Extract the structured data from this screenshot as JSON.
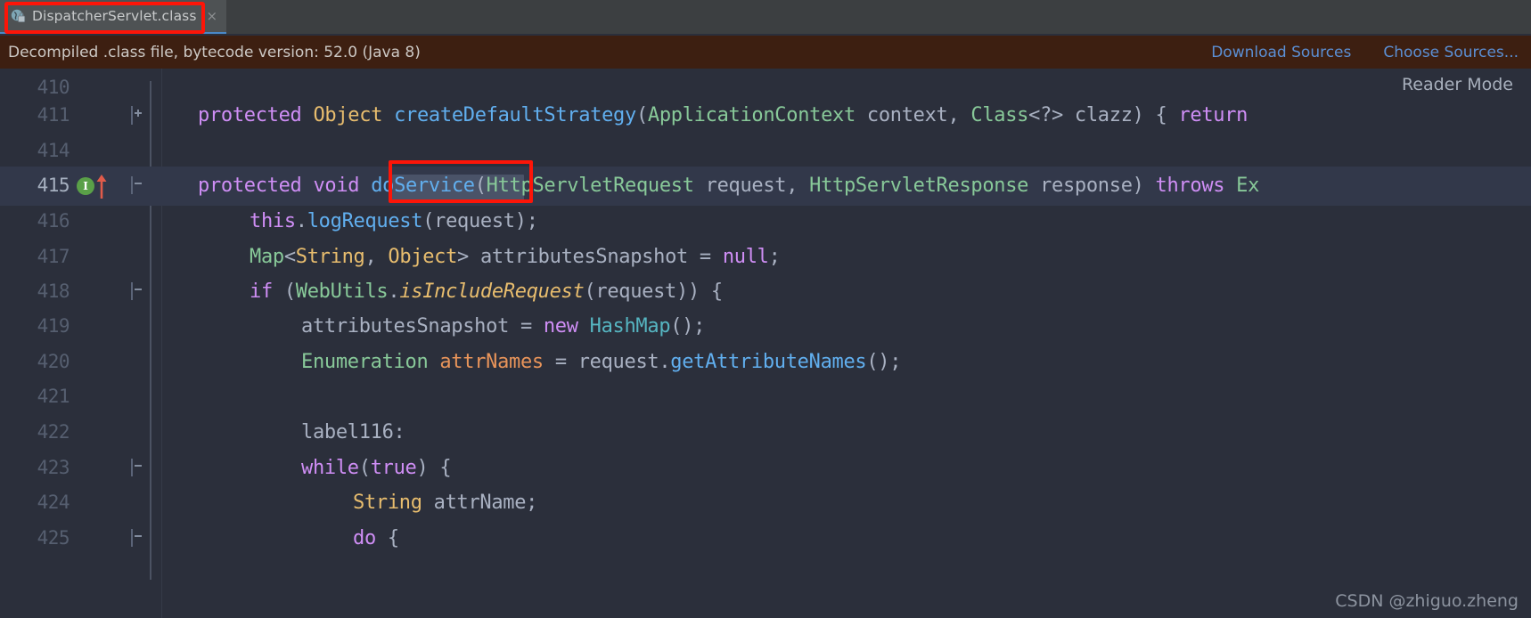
{
  "tab": {
    "label": "DispatcherServlet.class",
    "icon": "java-class-file-icon",
    "close_label": "×"
  },
  "notification": {
    "message": "Decompiled .class file, bytecode version: 52.0 (Java 8)",
    "links": [
      {
        "label": "Download Sources",
        "name": "download-sources-link"
      },
      {
        "label": "Choose Sources...",
        "name": "choose-sources-link"
      }
    ]
  },
  "editor": {
    "reader_mode_label": "Reader Mode",
    "lines": [
      {
        "no": "410",
        "indent": 0,
        "text": ""
      },
      {
        "no": "411",
        "indent": 0,
        "text": "protected Object createDefaultStrategy(ApplicationContext context, Class<?> clazz) { return"
      },
      {
        "no": "414",
        "indent": 0,
        "text": ""
      },
      {
        "no": "415",
        "indent": 0,
        "text": "protected void doService(HttpServletRequest request, HttpServletResponse response) throws Ex"
      },
      {
        "no": "416",
        "indent": 1,
        "text": "this.logRequest(request);"
      },
      {
        "no": "417",
        "indent": 1,
        "text": "Map<String, Object> attributesSnapshot = null;"
      },
      {
        "no": "418",
        "indent": 1,
        "text": "if (WebUtils.isIncludeRequest(request)) {"
      },
      {
        "no": "419",
        "indent": 2,
        "text": "attributesSnapshot = new HashMap();"
      },
      {
        "no": "420",
        "indent": 2,
        "text": "Enumeration attrNames = request.getAttributeNames();"
      },
      {
        "no": "421",
        "indent": 0,
        "text": ""
      },
      {
        "no": "422",
        "indent": 2,
        "text": "label116:"
      },
      {
        "no": "423",
        "indent": 2,
        "text": "while(true) {"
      },
      {
        "no": "424",
        "indent": 3,
        "text": "String attrName;"
      },
      {
        "no": "425",
        "indent": 3,
        "text": "do {"
      }
    ],
    "selected_token": "doService",
    "current_line": "415"
  },
  "annotations": {
    "tab_highlight_color": "#fd1508",
    "method_highlight_color": "#fd1508"
  },
  "watermark": "CSDN @zhiguo.zheng",
  "colors": {
    "editor_bg": "#2b2f3b",
    "notification_bg": "#3d1f11",
    "tab_active_bg": "#4e5254",
    "link": "#5b8fd4",
    "keyword": "#cf8ef5",
    "type": "#e8bd6e",
    "class": "#88c999",
    "method": "#61afef"
  }
}
